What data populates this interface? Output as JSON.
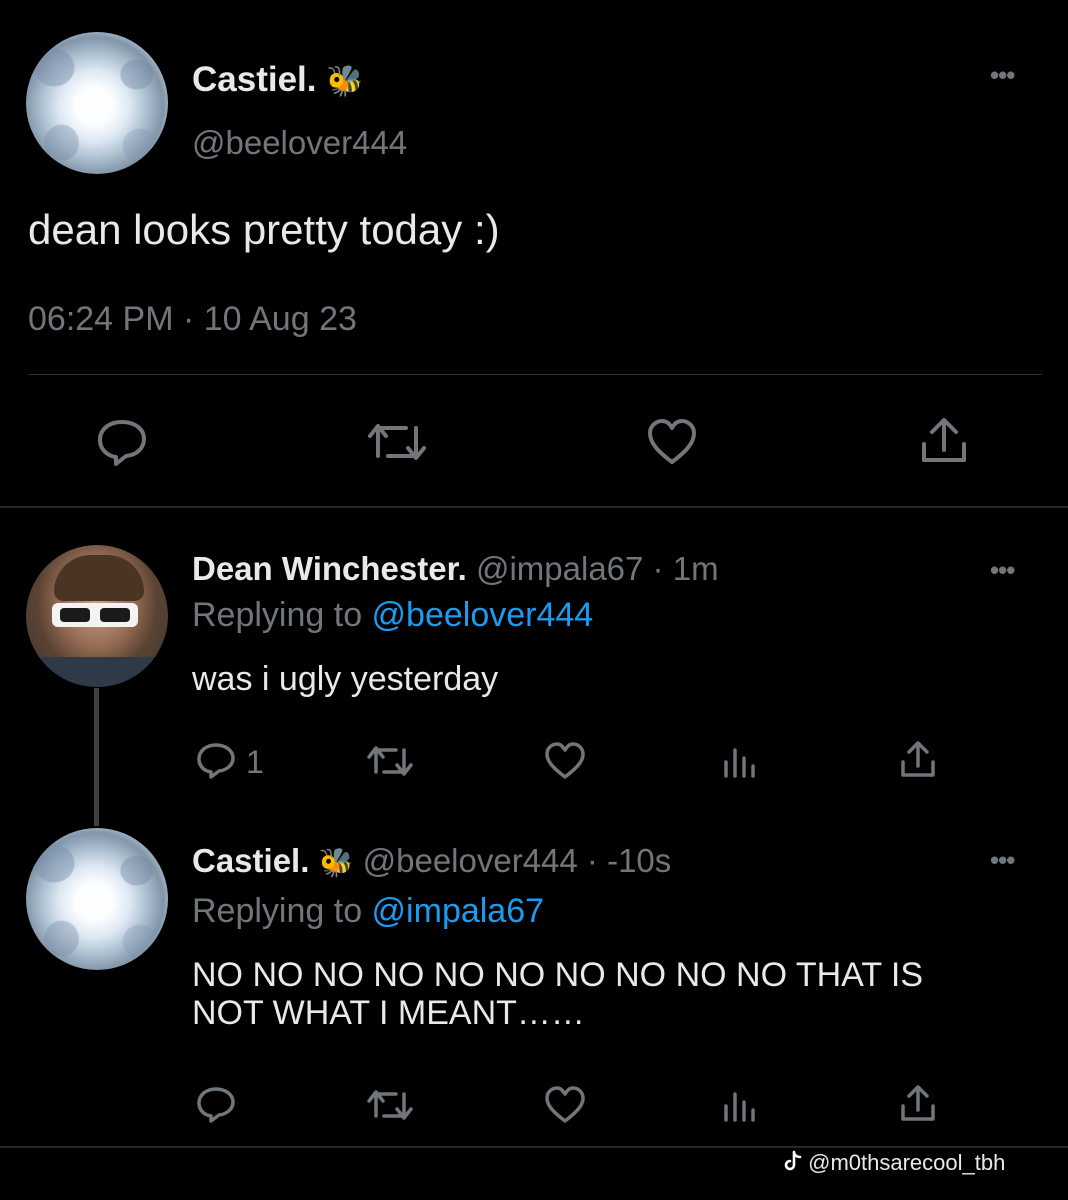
{
  "main_tweet": {
    "author_name": "Castiel.",
    "author_emoji": "🐝",
    "handle": "@beelover444",
    "text": "dean looks pretty today :)",
    "timestamp": "06:24 PM · 10 Aug 23"
  },
  "reply1": {
    "author_name": "Dean Winchester.",
    "handle_time": "@impala67 · 1m",
    "replying_prefix": "Replying to ",
    "replying_handle": "@beelover444",
    "text": "was i ugly yesterday",
    "reply_count": "1"
  },
  "reply2": {
    "author_name": "Castiel.",
    "author_emoji": "🐝",
    "handle_time": "@beelover444 · -10s",
    "replying_prefix": "Replying to ",
    "replying_handle": "@impala67",
    "text_line1": "NO NO NO NO NO NO NO NO NO NO THAT IS",
    "text_line2": "NOT WHAT I MEANT……"
  },
  "watermark": {
    "icon": "tiktok-icon",
    "text": "@m0thsarecool_tbh"
  },
  "icons": [
    "reply-icon",
    "retweet-icon",
    "like-icon",
    "views-icon",
    "share-icon",
    "more-icon"
  ],
  "colors": {
    "background": "#000000",
    "text": "#e7e9ea",
    "muted": "#71767b",
    "link": "#1d9bf0",
    "divider": "#2f3336"
  }
}
